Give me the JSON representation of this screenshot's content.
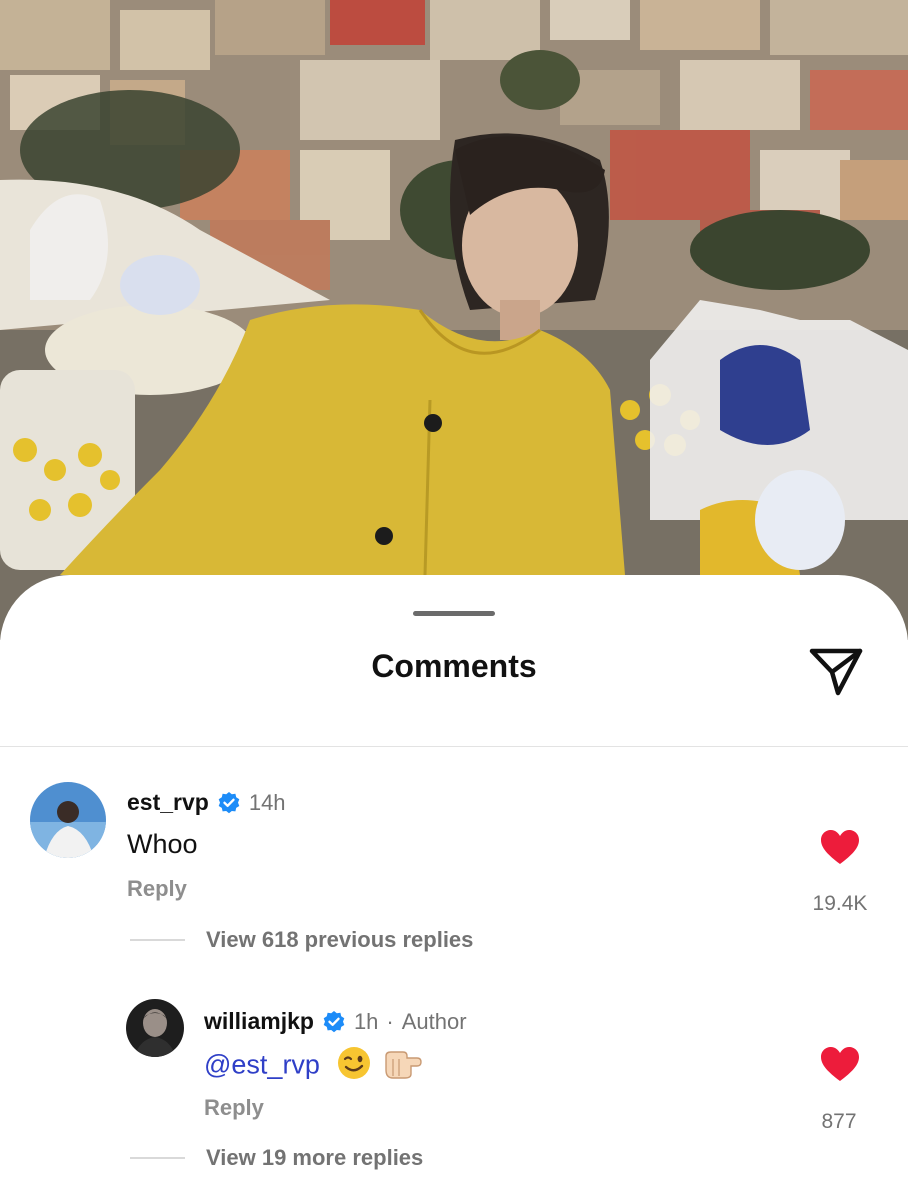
{
  "sheet": {
    "title": "Comments",
    "share_icon": "send-icon"
  },
  "comments": [
    {
      "username": "est_rvp",
      "verified": true,
      "time": "14h",
      "text": "Whoo",
      "reply_label": "Reply",
      "likes": "19.4K",
      "liked": true,
      "view_replies": "View 618 previous replies"
    },
    {
      "username": "williamjkp",
      "verified": true,
      "time": "1h",
      "author_tag": "Author",
      "mention": "@est_rvp",
      "emojis": [
        "winking-face-emoji",
        "pointing-hand-emoji"
      ],
      "reply_label": "Reply",
      "likes": "877",
      "liked": true,
      "view_replies": "View 19 more replies"
    }
  ],
  "colors": {
    "like_red": "#ed1c3b",
    "verified_blue": "#1d8cf8",
    "mention_blue": "#2f3fc7",
    "jacket_yellow": "#d8b836"
  }
}
